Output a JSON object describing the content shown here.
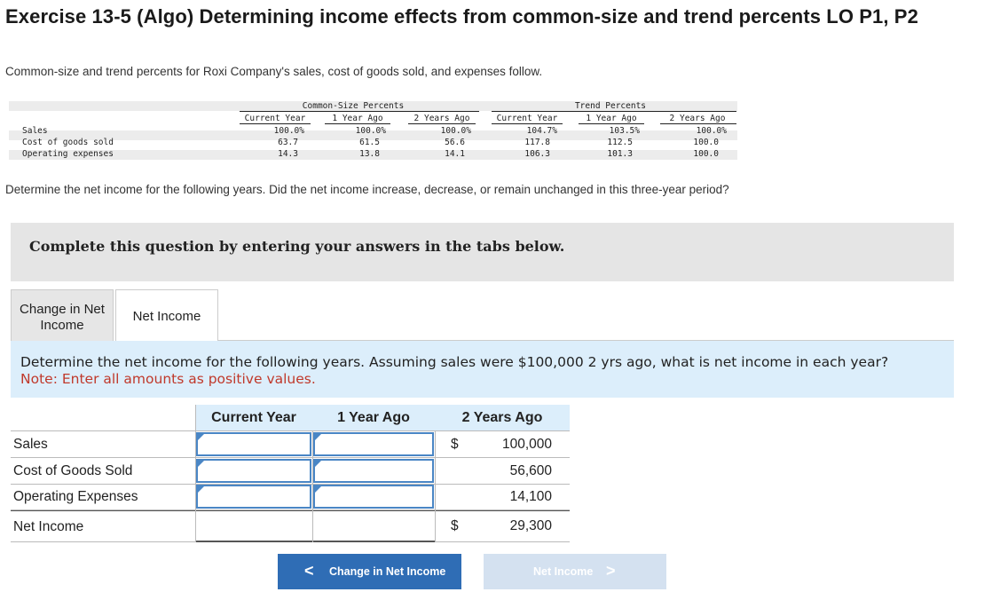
{
  "title": "Exercise 13-5 (Algo) Determining income effects from common-size and trend percents LO P1, P2",
  "intro": "Common-size and trend percents for Roxi Company's sales, cost of goods sold, and expenses follow.",
  "data_table": {
    "group1": "Common-Size Percents",
    "group2": "Trend Percents",
    "columns": [
      "Current Year",
      "1 Year Ago",
      "2 Years Ago",
      "Current Year",
      "1 Year Ago",
      "2 Years Ago"
    ],
    "rows": [
      {
        "label": "Sales",
        "values": [
          "100.0%",
          "100.0%",
          "100.0%",
          "104.7%",
          "103.5%",
          "100.0%"
        ]
      },
      {
        "label": "Cost of goods sold",
        "values": [
          "63.7",
          "61.5",
          "56.6",
          "117.8",
          "112.5",
          "100.0"
        ]
      },
      {
        "label": "Operating expenses",
        "values": [
          "14.3",
          "13.8",
          "14.1",
          "106.3",
          "101.3",
          "100.0"
        ]
      }
    ]
  },
  "question": "Determine the net income for the following years. Did the net income increase, decrease, or remain unchanged in this three-year period?",
  "instruction": "Complete this question by entering your answers in the tabs below.",
  "tabs": [
    {
      "label_line1": "Change in Net",
      "label_line2": "Income"
    },
    {
      "label": "Net Income"
    }
  ],
  "panel": {
    "text": "Determine the net income for the following years. Assuming sales were $100,000 2 yrs ago, what is net income in each year?",
    "note": "Note: Enter all amounts as positive values."
  },
  "answer_table": {
    "headers": [
      "Current Year",
      "1 Year Ago",
      "2 Years Ago"
    ],
    "rows": [
      {
        "label": "Sales",
        "current": "",
        "one_year": "",
        "dollar": "$",
        "two_years": "100,000"
      },
      {
        "label": "Cost of Goods Sold",
        "current": "",
        "one_year": "",
        "dollar": "",
        "two_years": "56,600"
      },
      {
        "label": "Operating Expenses",
        "current": "",
        "one_year": "",
        "dollar": "",
        "two_years": "14,100"
      },
      {
        "label": "Net Income",
        "current": "",
        "one_year": "",
        "dollar": "$",
        "two_years": "29,300"
      }
    ]
  },
  "nav": {
    "prev_label": "Change in Net Income",
    "prev_arrow": "<",
    "next_label": "Net Income",
    "next_arrow": ">"
  }
}
